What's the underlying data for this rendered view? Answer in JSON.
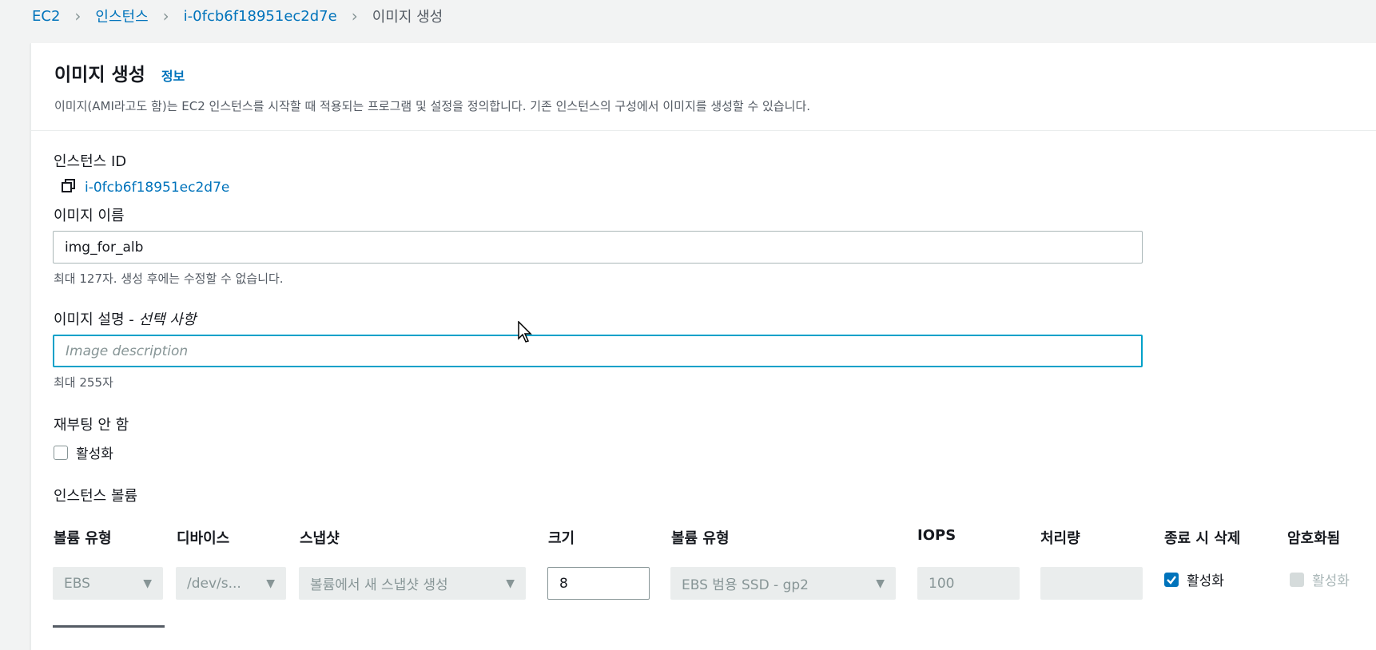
{
  "breadcrumb": {
    "items": [
      "EC2",
      "인스턴스",
      "i-0fcb6f18951ec2d7e"
    ],
    "current": "이미지 생성"
  },
  "header": {
    "title": "이미지 생성",
    "info_link": "정보",
    "description": "이미지(AMI라고도 함)는 EC2 인스턴스를 시작할 때 적용되는 프로그램 및 설정을 정의합니다. 기존 인스턴스의 구성에서 이미지를 생성할 수 있습니다."
  },
  "instance": {
    "label": "인스턴스 ID",
    "value": "i-0fcb6f18951ec2d7e"
  },
  "image_name": {
    "label": "이미지 이름",
    "value": "img_for_alb",
    "hint": "최대 127자. 생성 후에는 수정할 수 없습니다."
  },
  "image_desc": {
    "label": "이미지 설명 - ",
    "label_optional": "선택 사항",
    "placeholder": "Image description",
    "hint": "최대 255자"
  },
  "no_reboot": {
    "label": "재부팅 안 함",
    "checkbox_label": "활성화",
    "checked": false
  },
  "volumes": {
    "label": "인스턴스 볼륨",
    "columns": [
      "볼륨 유형",
      "디바이스",
      "스냅샷",
      "크기",
      "볼륨 유형",
      "IOPS",
      "처리량",
      "종료 시 삭제",
      "암호화됨"
    ],
    "row": {
      "volume_type": "EBS",
      "device": "/dev/s...",
      "snapshot": "볼륨에서 새 스냅샷 생성",
      "size": "8",
      "ebs_type": "EBS 범용 SSD - gp2",
      "iops": "100",
      "throughput": "",
      "delete_on_termination": "활성화",
      "encrypted": "활성화"
    }
  },
  "colors": {
    "link": "#0073bb",
    "focus": "#00a1c9",
    "background": "#f2f3f3"
  }
}
